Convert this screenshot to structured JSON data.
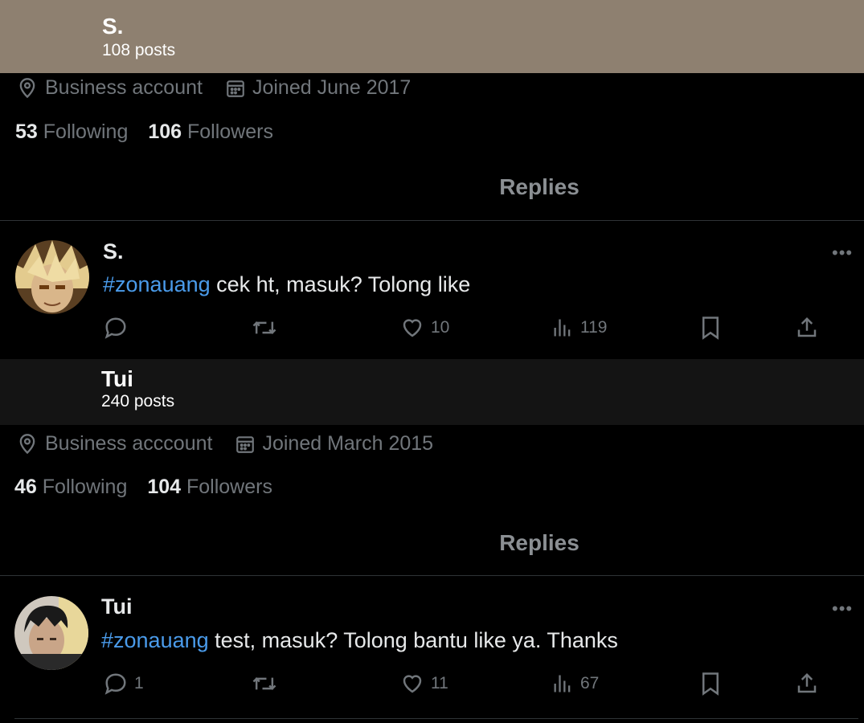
{
  "profile1": {
    "name": "S.",
    "posts": "108 posts",
    "category": "Business account",
    "joined": "Joined June 2017",
    "following_count": "53",
    "following_label": "Following",
    "followers_count": "106",
    "followers_label": "Followers",
    "tab": "Replies",
    "header_color": "#8e8070"
  },
  "post1": {
    "author": "S.",
    "hashtag": "#zonauang",
    "text": " cek ht, masuk? Tolong like",
    "more": "•••",
    "replies": "",
    "likes": "10",
    "views": "119"
  },
  "profile2": {
    "name": "Tui",
    "posts": "240 posts",
    "category": "Business acccount",
    "joined": "Joined March 2015",
    "following_count": "46",
    "following_label": "Following",
    "followers_count": "104",
    "followers_label": "Followers",
    "tab": "Replies",
    "header_color": "#141414"
  },
  "post2": {
    "author": "Tui",
    "hashtag": "#zonauang",
    "text": " test, masuk? Tolong bantu like ya. Thanks",
    "more": "•••",
    "replies": "1",
    "likes": "11",
    "views": "67"
  },
  "colors": {
    "hashtag": "#4a9bea",
    "muted": "#71767b",
    "background": "#000000"
  },
  "icons": [
    "location-icon",
    "calendar-icon",
    "reply-icon",
    "retweet-icon",
    "like-icon",
    "views-icon",
    "bookmark-icon",
    "share-icon",
    "more-icon"
  ]
}
